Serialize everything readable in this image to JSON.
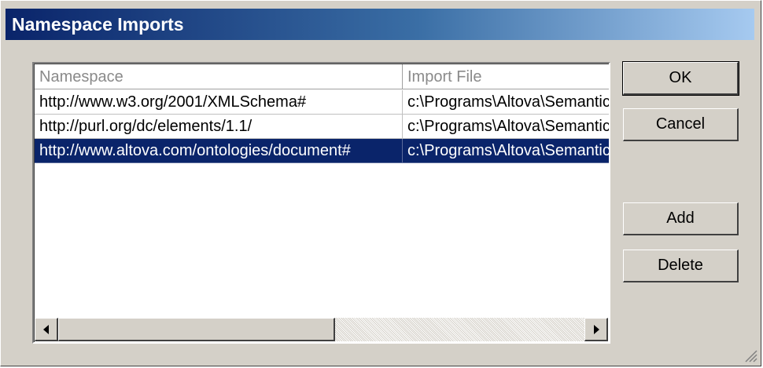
{
  "window": {
    "title": "Namespace Imports"
  },
  "table": {
    "columns": [
      "Namespace",
      "Import File"
    ],
    "rows": [
      {
        "namespace": "http://www.w3.org/2001/XMLSchema#",
        "import_file": "c:\\Programs\\Altova\\Semantic"
      },
      {
        "namespace": "http://purl.org/dc/elements/1.1/",
        "import_file": "c:\\Programs\\Altova\\Semantic"
      },
      {
        "namespace": "http://www.altova.com/ontologies/document#",
        "import_file": "c:\\Programs\\Altova\\Semantic"
      }
    ],
    "selected_row": 3
  },
  "buttons": {
    "ok": "OK",
    "cancel": "Cancel",
    "add": "Add",
    "delete": "Delete"
  },
  "colors": {
    "face": "#d4d0c8",
    "selection": "#0a246a",
    "title_start": "#0a246a",
    "title_end": "#a6caf0"
  },
  "icons": {
    "scroll_left": "scroll-left-arrow-icon",
    "scroll_right": "scroll-right-arrow-icon",
    "resize": "resize-grip-icon"
  }
}
